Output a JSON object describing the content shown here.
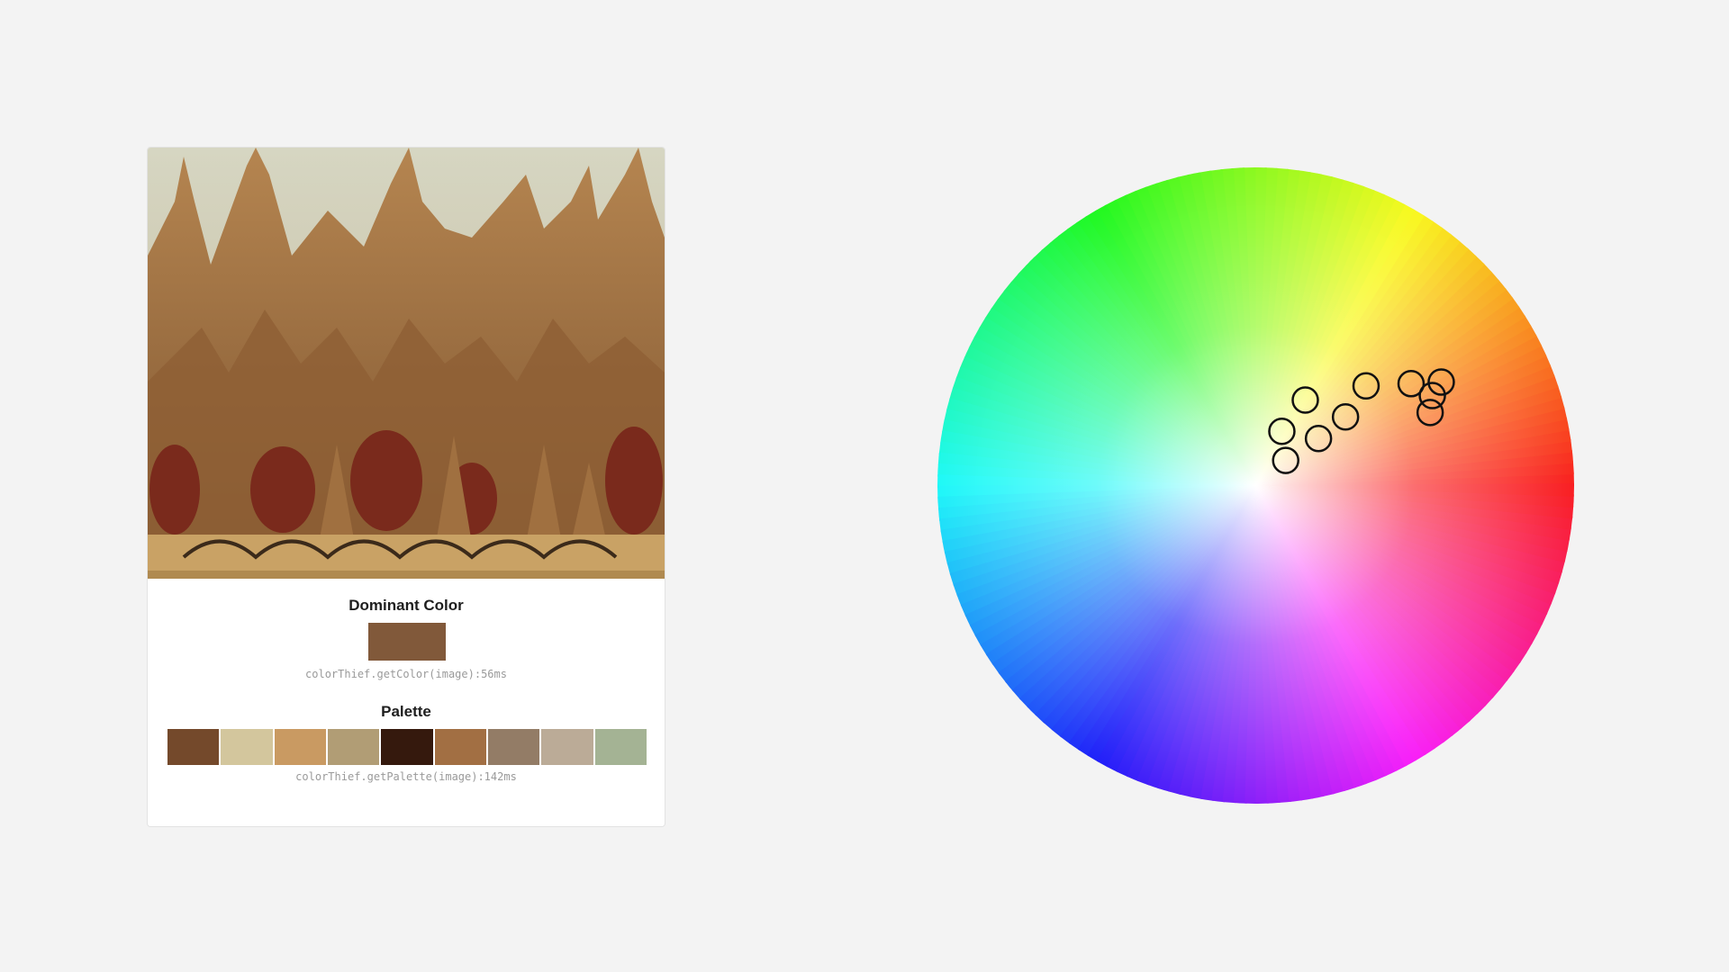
{
  "panel": {
    "dominant_title": "Dominant Color",
    "dominant_color": "#81593a",
    "dominant_caption": "colorThief.getColor(image):56ms",
    "palette_title": "Palette",
    "palette_colors": [
      "#74492b",
      "#d3c69d",
      "#c99a62",
      "#b19d75",
      "#35190d",
      "#a26f43",
      "#937c66",
      "#bbab97",
      "#a4b394"
    ],
    "palette_caption": "colorThief.getPalette(image):142ms"
  },
  "artwork": {
    "sky_color": "#c6cab6",
    "tree_color": "#9a6a3c",
    "accent_color": "#7a2a1c",
    "ground_color": "#c9a265"
  },
  "wheel": {
    "markers": [
      {
        "hue": 30,
        "saturation": 0.4
      },
      {
        "hue": 20,
        "saturation": 0.3
      },
      {
        "hue": 10,
        "saturation": 0.2
      },
      {
        "hue": -20,
        "saturation": 0.1
      },
      {
        "hue": 35,
        "saturation": 0.1
      },
      {
        "hue": 45,
        "saturation": 0.22
      },
      {
        "hue": 23,
        "saturation": 0.53
      },
      {
        "hue": 20,
        "saturation": 0.62
      },
      {
        "hue": 17,
        "saturation": 0.58
      },
      {
        "hue": 12,
        "saturation": 0.56
      }
    ]
  }
}
